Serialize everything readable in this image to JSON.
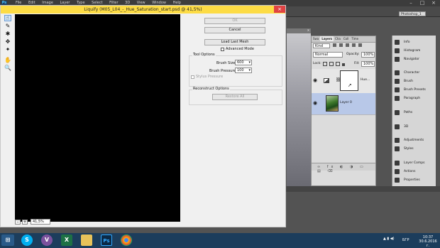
{
  "photoshop": {
    "menu": [
      "File",
      "Edit",
      "Image",
      "Layer",
      "Type",
      "Select",
      "Filter",
      "3D",
      "View",
      "Window",
      "Help"
    ],
    "workspace": "Photoshop_1",
    "canvas_tab": "x"
  },
  "liquify": {
    "title": "Liquify (M05_L04_-_Hue_Saturation_start.psd @ 41,5%)",
    "ok_label": "OK",
    "cancel_label": "Cancel",
    "load_mesh_label": "Load Last Mesh",
    "advanced_mode_label": "Advanced Mode",
    "tool_options_title": "Tool Options",
    "brush_size_label": "Brush Size:",
    "brush_size_value": "600",
    "brush_pressure_label": "Brush Pressure:",
    "brush_pressure_value": "100",
    "stylus_pressure_label": "Stylus Pressure",
    "reconstruct_title": "Reconstruct Options",
    "restore_all_label": "Restore All",
    "zoom_value": "41,5%"
  },
  "layers_panel": {
    "tabs": [
      "Swa",
      "Layers",
      "Cha",
      "Coll",
      "Time"
    ],
    "kind_label": "Kind",
    "blend_mode": "Normal",
    "opacity_label": "Opacity:",
    "opacity_value": "100%",
    "lock_label": "Lock:",
    "fill_label": "Fill:",
    "fill_value": "100%",
    "layers": [
      {
        "name": "Hue..."
      },
      {
        "name": "Layer 0"
      }
    ]
  },
  "right_dock": {
    "items": [
      "Info",
      "Histogram",
      "Navigator",
      "Character",
      "Brush",
      "Brush Presets",
      "Paragraph",
      "Paths",
      "3D",
      "Adjustments",
      "Styles",
      "Layer Comps",
      "Actions",
      "Properties"
    ]
  },
  "taskbar": {
    "apps": [
      "S",
      "V",
      "X",
      "",
      "Ps",
      ""
    ],
    "lang": "БГР",
    "time": "10:37",
    "date": "30.6.2016 г."
  },
  "colors": {
    "dialog_title": "#fddc45",
    "taskbar": "#1c3d5c",
    "selected_layer": "#b8c8e8"
  }
}
